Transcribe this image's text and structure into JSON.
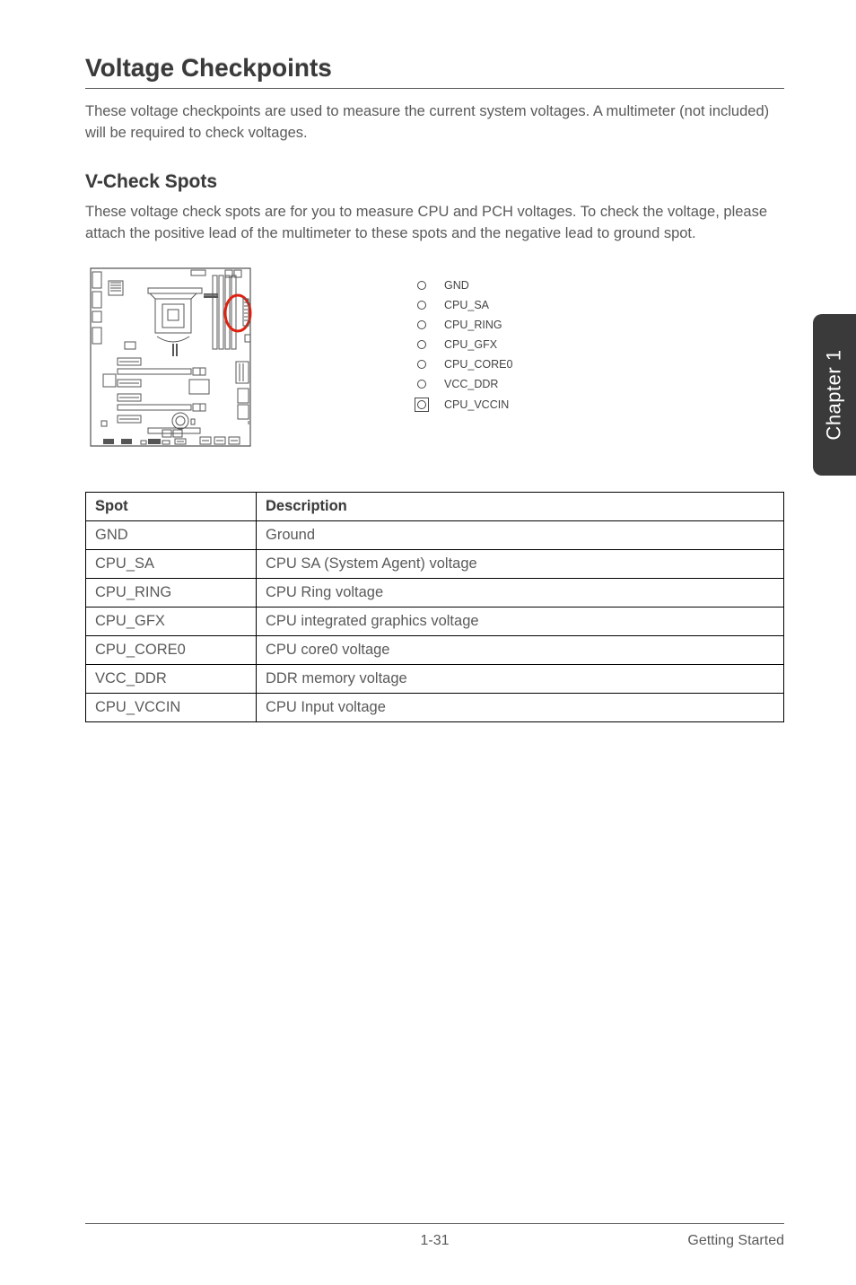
{
  "sideTab": "Chapter 1",
  "heading": "Voltage Checkpoints",
  "intro": "These voltage checkpoints are used to measure the current system voltages. A multimeter (not included) will be required to check voltages.",
  "subheading": "V-Check Spots",
  "subintro": "These voltage check spots are for you to measure CPU and PCH voltages. To check the voltage, please attach the positive lead of the multimeter to these spots and the negative lead to ground spot.",
  "legend": [
    {
      "label": "GND",
      "boxed": false
    },
    {
      "label": "CPU_SA",
      "boxed": false
    },
    {
      "label": "CPU_RING",
      "boxed": false
    },
    {
      "label": "CPU_GFX",
      "boxed": false
    },
    {
      "label": "CPU_CORE0",
      "boxed": false
    },
    {
      "label": "VCC_DDR",
      "boxed": false
    },
    {
      "label": "CPU_VCCIN",
      "boxed": true
    }
  ],
  "table": {
    "headers": {
      "spot": "Spot",
      "desc": "Description"
    },
    "rows": [
      {
        "spot": "GND",
        "desc": "Ground"
      },
      {
        "spot": "CPU_SA",
        "desc": "CPU SA (System Agent) voltage"
      },
      {
        "spot": "CPU_RING",
        "desc": "CPU Ring voltage"
      },
      {
        "spot": "CPU_GFX",
        "desc": "CPU integrated graphics voltage"
      },
      {
        "spot": "CPU_CORE0",
        "desc": "CPU core0 voltage"
      },
      {
        "spot": "VCC_DDR",
        "desc": "DDR memory voltage"
      },
      {
        "spot": "CPU_VCCIN",
        "desc": "CPU Input voltage"
      }
    ]
  },
  "footer": {
    "page": "1-31",
    "section": "Getting Started"
  }
}
